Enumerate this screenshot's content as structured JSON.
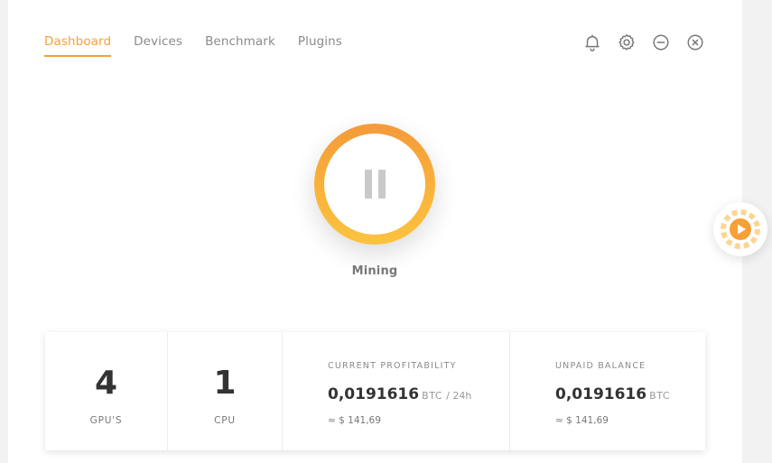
{
  "nav": {
    "tabs": [
      {
        "label": "Dashboard",
        "active": true
      },
      {
        "label": "Devices",
        "active": false
      },
      {
        "label": "Benchmark",
        "active": false
      },
      {
        "label": "Plugins",
        "active": false
      }
    ]
  },
  "header_icons": [
    "bell-icon",
    "gear-icon",
    "minimize-icon",
    "close-icon"
  ],
  "mining": {
    "status_label": "Mining",
    "state": "paused-control"
  },
  "stats": {
    "gpus": {
      "value": "4",
      "label": "GPU'S"
    },
    "cpu": {
      "value": "1",
      "label": "CPU"
    },
    "profitability": {
      "caption": "CURRENT PROFITABILITY",
      "value": "0,0191616",
      "unit": "BTC",
      "period": "/ 24h",
      "usd": "≈ $ 141,69"
    },
    "balance": {
      "caption": "UNPAID BALANCE",
      "value": "0,0191616",
      "unit": "BTC",
      "usd": "≈ $ 141,69"
    }
  },
  "colors": {
    "accent": "#f7a035",
    "gradient_start": "#f49a3a",
    "gradient_end": "#fcc23f",
    "text_dark": "#333333",
    "text_muted": "#8a8a8a"
  }
}
